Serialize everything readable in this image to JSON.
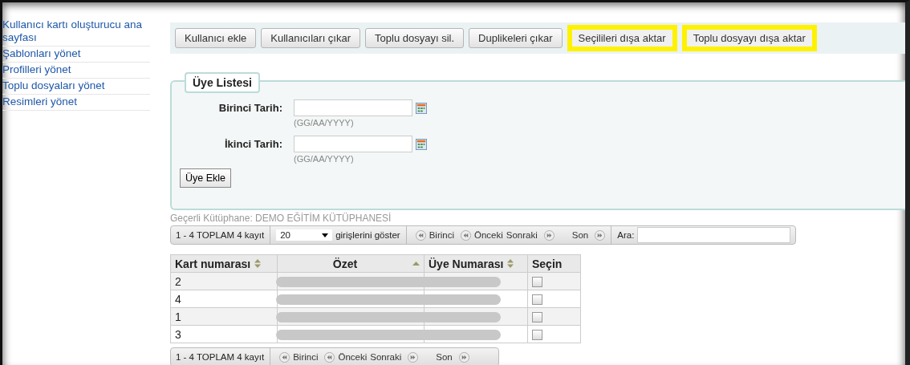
{
  "sidebar": {
    "items": [
      {
        "label": "Kullanıcı kartı oluşturucu ana sayfası"
      },
      {
        "label": "Şablonları yönet"
      },
      {
        "label": "Profilleri yönet"
      },
      {
        "label": "Toplu dosyaları yönet"
      },
      {
        "label": "Resimleri yönet"
      }
    ]
  },
  "toolbar": {
    "buttons": [
      {
        "label": "Kullanıcı ekle",
        "highlighted": false
      },
      {
        "label": "Kullanıcıları çıkar",
        "highlighted": false
      },
      {
        "label": "Toplu dosyayı sil.",
        "highlighted": false
      },
      {
        "label": "Duplikeleri çıkar",
        "highlighted": false
      },
      {
        "label": "Seçilileri dışa aktar",
        "highlighted": true
      },
      {
        "label": "Toplu dosyayı dışa aktar",
        "highlighted": true
      }
    ]
  },
  "form": {
    "legend": "Üye Listesi",
    "fields": [
      {
        "label": "Birinci Tarih:",
        "hint": "(GG/AA/YYYY)"
      },
      {
        "label": "İkinci Tarih:",
        "hint": "(GG/AA/YYYY)"
      }
    ],
    "submit": "Üye Ekle"
  },
  "library": "Geçerli Kütüphane: DEMO EĞİTİM KÜTÜPHANESİ",
  "pager_top": {
    "info": "1 - 4 TOPLAM 4 kayıt",
    "page_size": "20",
    "page_size_label": "girişlerini göster",
    "first": "Birinci",
    "prev": "Önceki",
    "next": "Sonraki",
    "last": "Son",
    "search_label": "Ara:"
  },
  "table": {
    "columns": [
      {
        "label": "Kart numarası",
        "kind": "sortable"
      },
      {
        "label": "Özet",
        "kind": "ascending"
      },
      {
        "label": "Üye Numarası",
        "kind": "sortable"
      },
      {
        "label": "Seçin",
        "kind": "plain"
      }
    ],
    "rows": [
      {
        "card": "2",
        "checked": false
      },
      {
        "card": "4",
        "checked": false
      },
      {
        "card": "1",
        "checked": false
      },
      {
        "card": "3",
        "checked": false
      }
    ]
  },
  "pager_bottom": {
    "info": "1 - 4 TOPLAM 4 kayıt",
    "first": "Birinci",
    "prev": "Önceki",
    "next": "Sonraki",
    "last": "Son"
  }
}
